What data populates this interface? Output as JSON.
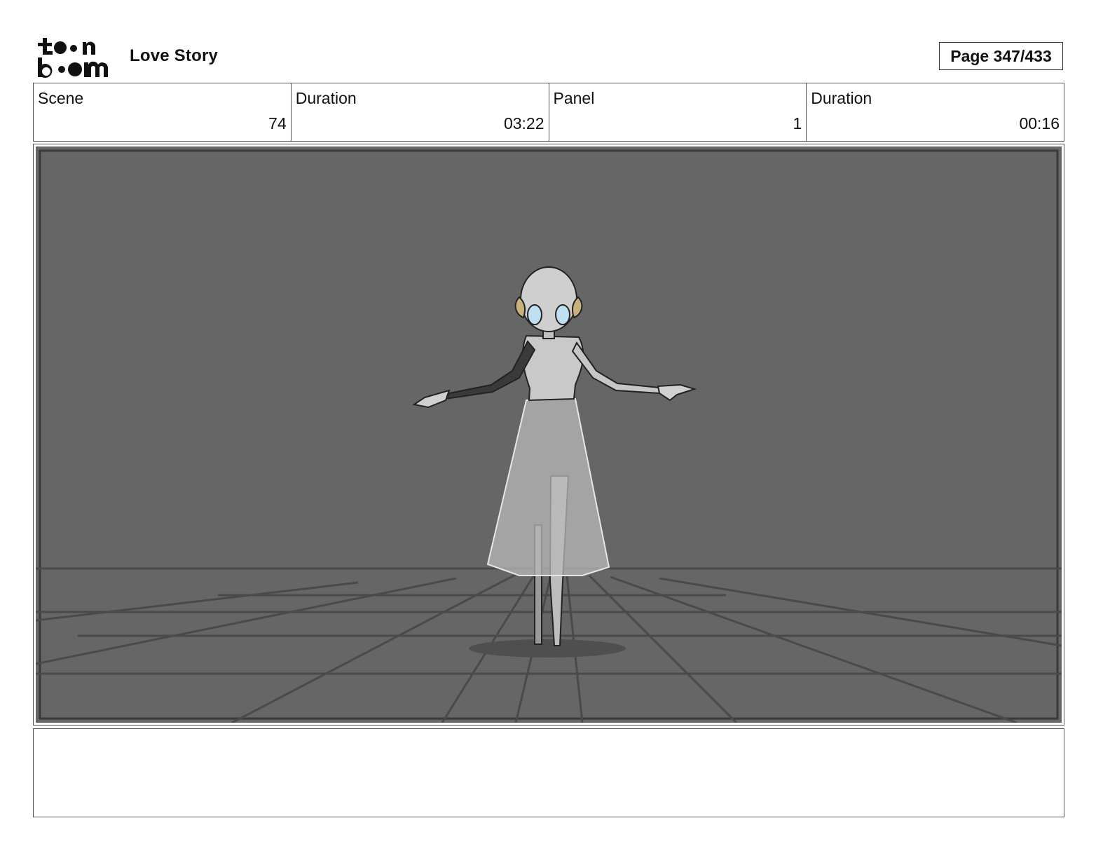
{
  "header": {
    "logo": {
      "line1": "toon",
      "line2": "boom",
      "icon": "toon-boom-logo"
    },
    "project_title": "Love Story",
    "page_label": "Page 347/433"
  },
  "info": {
    "scene_label": "Scene",
    "scene_value": "74",
    "scene_duration_label": "Duration",
    "scene_duration_value": "03:22",
    "panel_label": "Panel",
    "panel_value": "1",
    "panel_duration_label": "Duration",
    "panel_duration_value": "00:16"
  },
  "panel": {
    "image": "storyboard-panel-robot-doll-dancer",
    "colors": {
      "background": "#666666",
      "floor_lines": "#4a4a4a",
      "figure": "#c9c9c9",
      "ornament": "#c8b27a",
      "eyes": "#bfe0f0"
    }
  },
  "notes": {
    "text": ""
  }
}
